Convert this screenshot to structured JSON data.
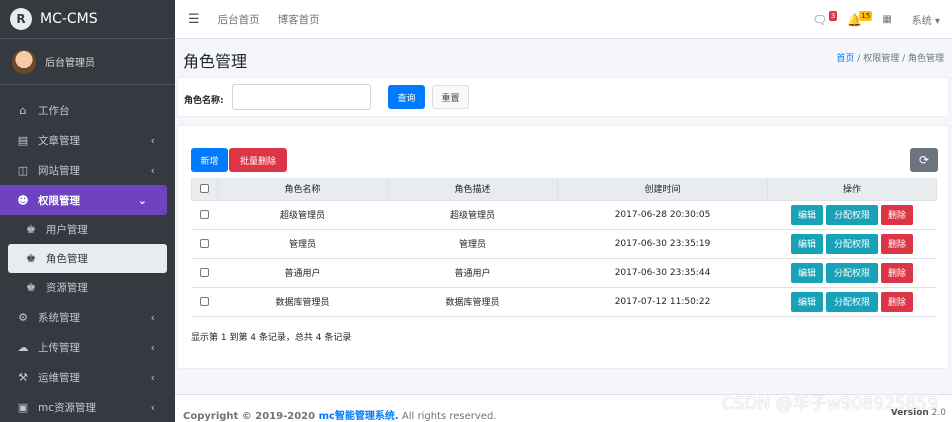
{
  "app": {
    "brand": "MC-CMS",
    "user_name": "后台管理员"
  },
  "sidebar": {
    "items": [
      {
        "label": "工作台",
        "icon": "home-icon"
      },
      {
        "label": "文章管理",
        "icon": "list-icon"
      },
      {
        "label": "网站管理",
        "icon": "window-icon"
      },
      {
        "label": "权限管理",
        "icon": "users-icon"
      },
      {
        "label": "用户管理",
        "icon": "user-tie-icon"
      },
      {
        "label": "角色管理",
        "icon": "user-tie-icon"
      },
      {
        "label": "资源管理",
        "icon": "user-tie-icon"
      },
      {
        "label": "系统管理",
        "icon": "gear-icon"
      },
      {
        "label": "上传管理",
        "icon": "cloud-upload-icon"
      },
      {
        "label": "运维管理",
        "icon": "ops-icon"
      },
      {
        "label": "mc资源管理",
        "icon": "card-icon"
      }
    ]
  },
  "topbar": {
    "link1": "后台首页",
    "link2": "博客首页",
    "msg_count": "3",
    "notice_count": "15",
    "system_label": "系统"
  },
  "header": {
    "title": "角色管理",
    "crumb_home": "首页",
    "crumb_mid": "权限管理",
    "crumb_current": "角色管理"
  },
  "search": {
    "label": "角色名称:",
    "query_btn": "查询",
    "reset_btn": "重置"
  },
  "toolbar": {
    "new_btn": "新增",
    "batch_delete_btn": "批量删除"
  },
  "table": {
    "columns": [
      "角色名称",
      "角色描述",
      "创建时间",
      "操作"
    ],
    "rows": [
      {
        "name": "超级管理员",
        "desc": "超级管理员",
        "time": "2017-06-28 20:30:05"
      },
      {
        "name": "管理员",
        "desc": "管理员",
        "time": "2017-06-30 23:35:19"
      },
      {
        "name": "普通用户",
        "desc": "普通用户",
        "time": "2017-06-30 23:35:44"
      },
      {
        "name": "数据库管理员",
        "desc": "数据库管理员",
        "time": "2017-07-12 11:50:22"
      }
    ],
    "ops": {
      "edit": "编辑",
      "perm": "分配权限",
      "del": "删除"
    },
    "pager": "显示第 1 到第 4 条记录，总共 4 条记录"
  },
  "footer": {
    "copyright_prefix": "Copyright © 2019-2020 ",
    "brand": "mc智能管理系统.",
    "suffix": " All rights reserved.",
    "version_label": "Version",
    "version": "2.0"
  },
  "watermark": "CSDN @华子w908925859"
}
